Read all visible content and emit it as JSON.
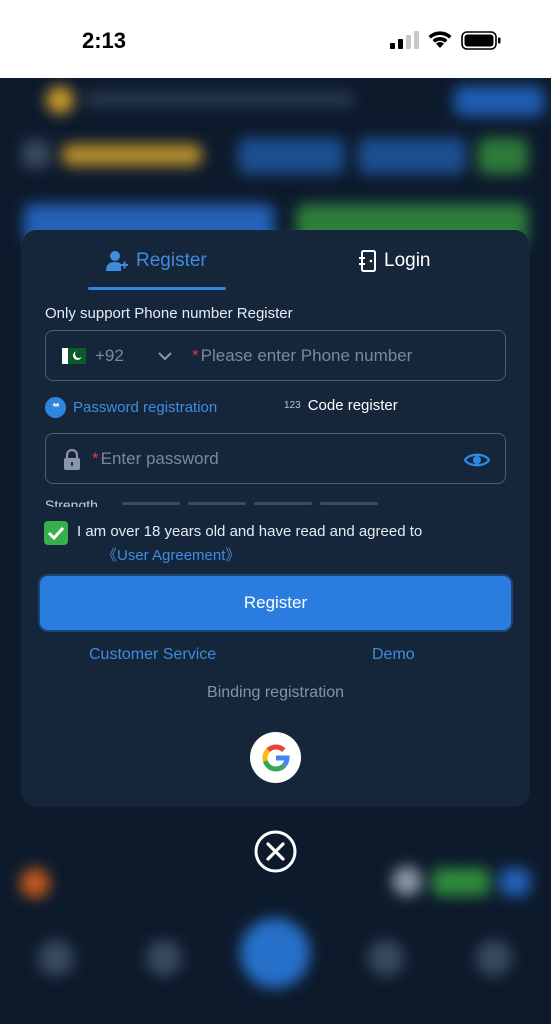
{
  "status_bar": {
    "time": "2:13"
  },
  "modal": {
    "tabs": {
      "register": "Register",
      "login": "Login"
    },
    "hint": "Only support Phone number Register",
    "phone": {
      "country_code": "+92",
      "required_mark": "*",
      "placeholder": "Please enter Phone number"
    },
    "options": {
      "password_badge": "**",
      "password_label": "Password registration",
      "code_badge": "123",
      "code_label": "Code register"
    },
    "password": {
      "required_mark": "*",
      "placeholder": "Enter password"
    },
    "strength_label": "Strength",
    "agreement": {
      "text": "I am over 18 years old and have read and agreed to",
      "link": "《User Agreement》",
      "checked": true
    },
    "register_button": "Register",
    "links": {
      "customer_service": "Customer Service",
      "demo": "Demo"
    },
    "binding_label": "Binding registration"
  },
  "colors": {
    "accent": "#2a7dde",
    "link": "#3f8cdf",
    "checkbox": "#35b04b",
    "modal_bg": "#15263b",
    "required": "#e0393e"
  },
  "icons": [
    "user-plus-icon",
    "login-door-icon",
    "pakistan-flag-icon",
    "chevron-down-icon",
    "lock-icon",
    "eye-icon",
    "checkmark-icon",
    "google-icon",
    "close-circle-icon",
    "signal-icon",
    "wifi-icon",
    "battery-icon"
  ]
}
